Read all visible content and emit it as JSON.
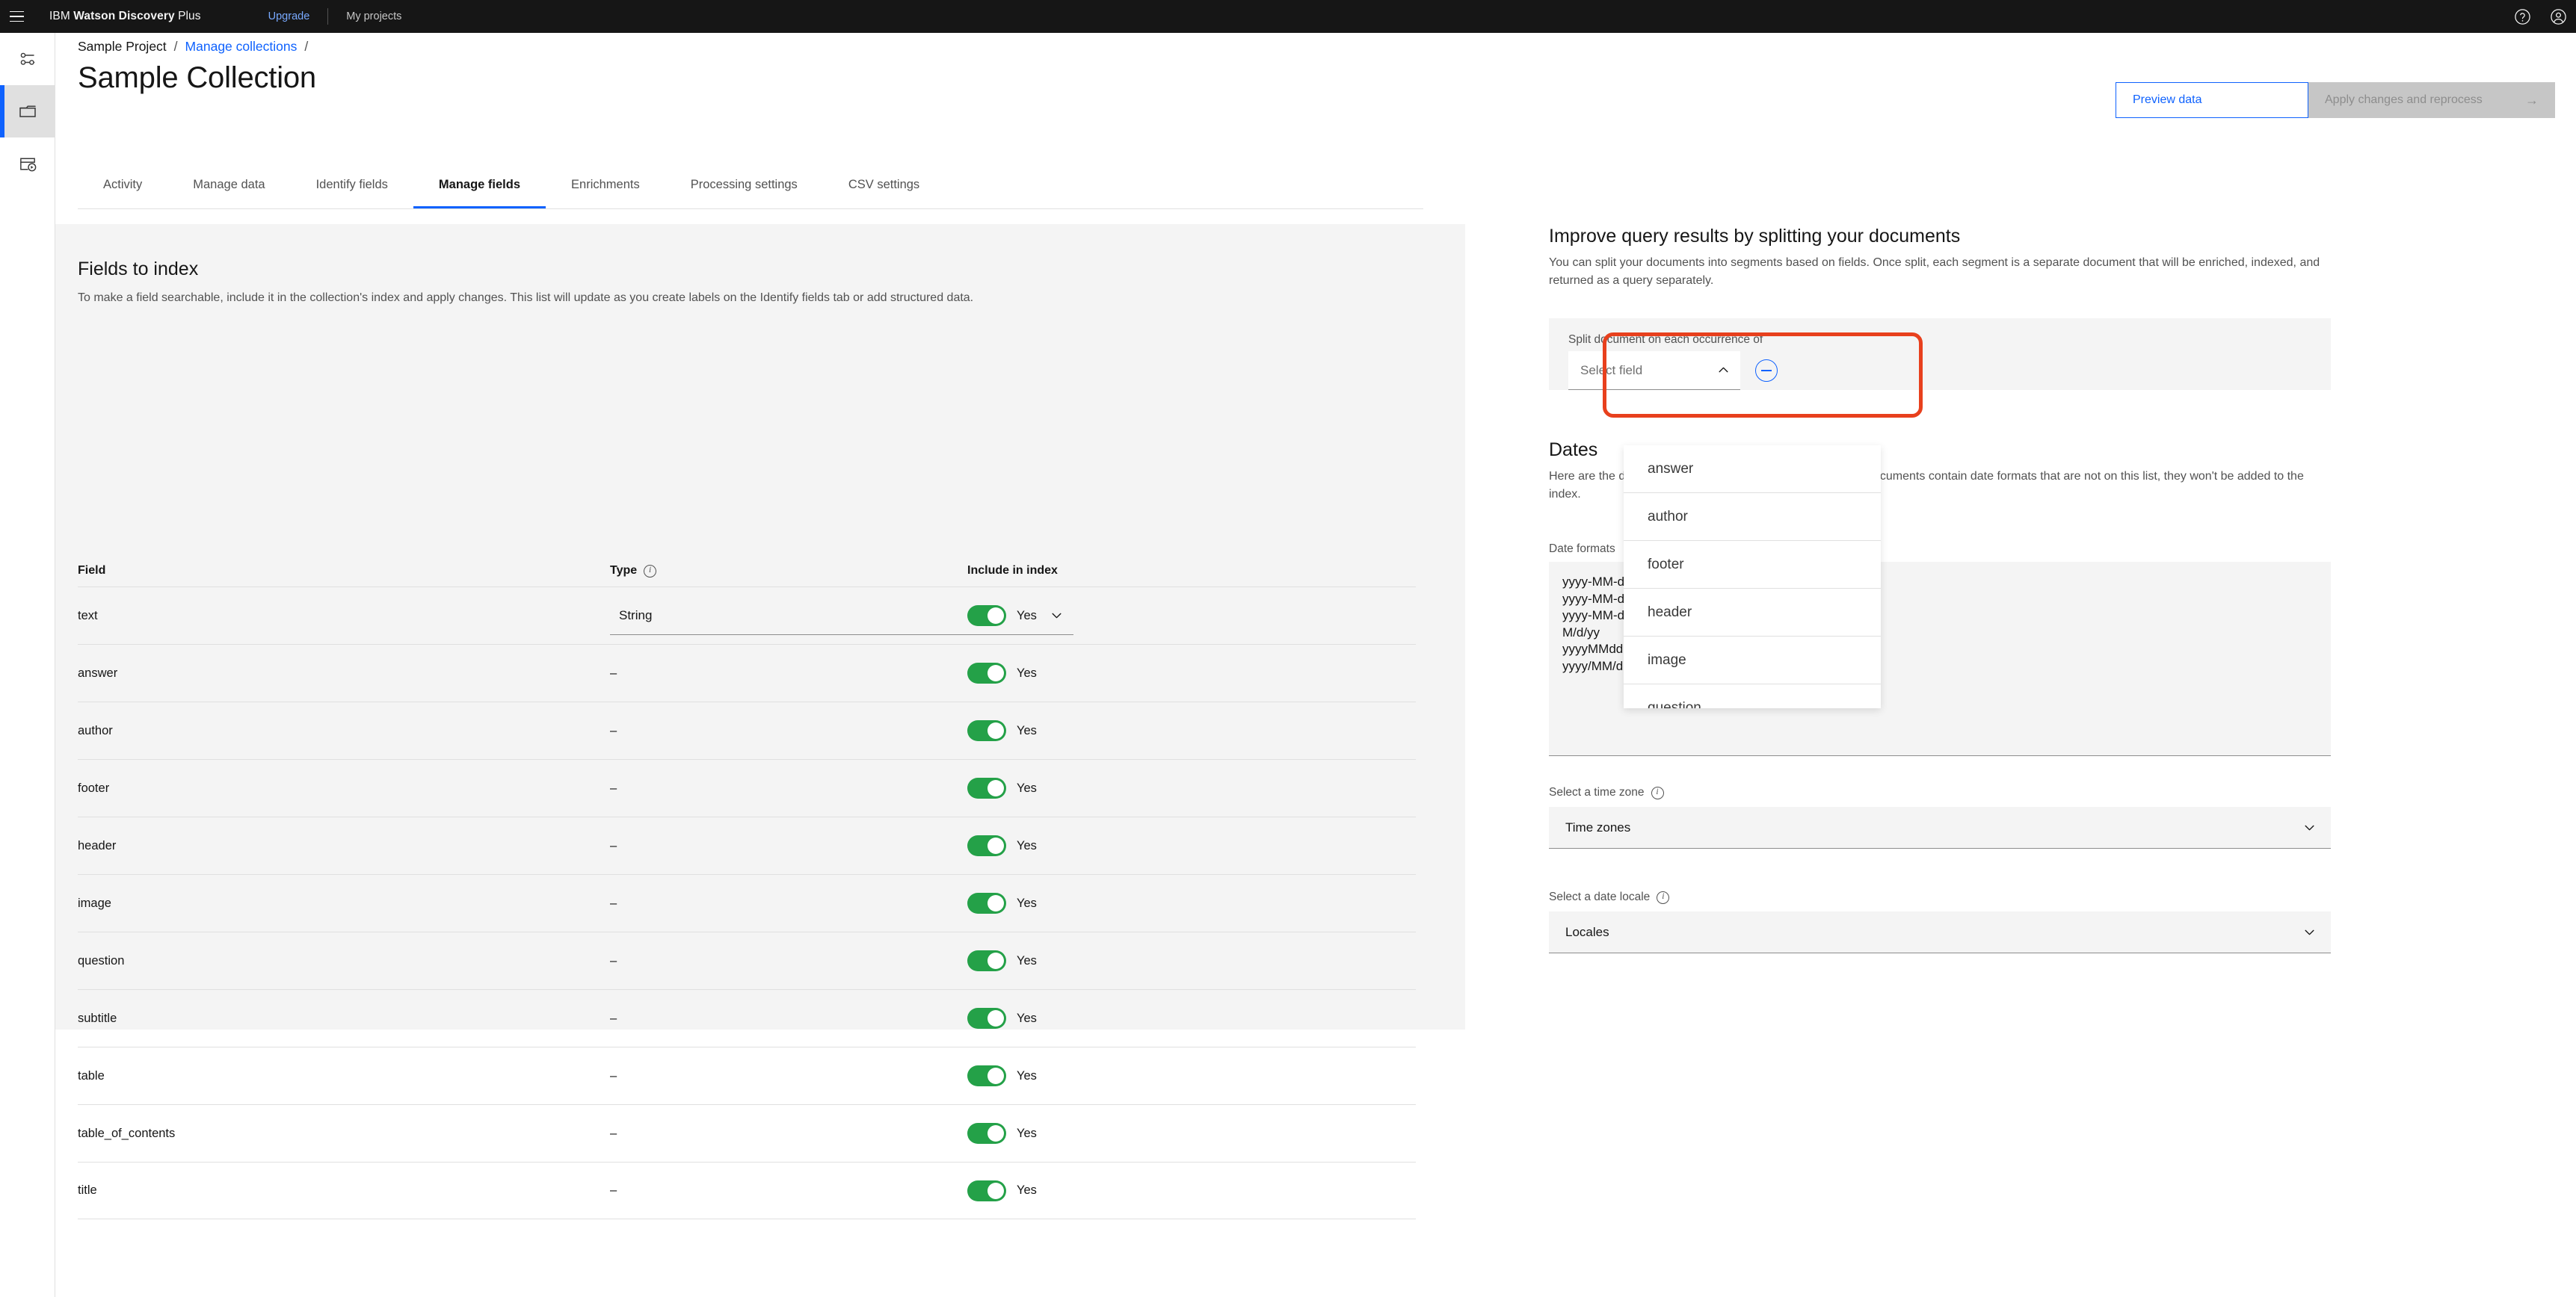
{
  "topbar": {
    "menu_icon": "hamburger-icon",
    "brand_prefix": "IBM ",
    "brand_bold": "Watson Discovery",
    "brand_suffix": " Plus",
    "nav": [
      {
        "label": "Upgrade",
        "style": "link"
      },
      {
        "label": "My projects",
        "style": "plain"
      }
    ],
    "help_icon": "help-icon",
    "account_icon": "user-avatar-icon"
  },
  "rail": {
    "items": [
      {
        "icon": "settings-sliders-icon",
        "active": false
      },
      {
        "icon": "folder-icon",
        "active": true
      },
      {
        "icon": "document-play-icon",
        "active": false
      }
    ]
  },
  "breadcrumb": {
    "items": [
      {
        "label": "Sample Project",
        "link": false
      },
      {
        "label": "Manage collections",
        "link": true
      }
    ],
    "separator": "/",
    "trailing_separator": "/"
  },
  "page": {
    "title": "Sample Collection"
  },
  "header_actions": {
    "preview_label": "Preview data",
    "apply_label": "Apply changes and reprocess",
    "apply_arrow": "→",
    "apply_disabled": true
  },
  "tabs": [
    {
      "label": "Activity",
      "active": false
    },
    {
      "label": "Manage data",
      "active": false
    },
    {
      "label": "Identify fields",
      "active": false
    },
    {
      "label": "Manage fields",
      "active": true
    },
    {
      "label": "Enrichments",
      "active": false
    },
    {
      "label": "Processing settings",
      "active": false
    },
    {
      "label": "CSV settings",
      "active": false
    }
  ],
  "fields_card": {
    "title": "Fields to index",
    "subtitle": "To make a field searchable, include it in the collection's index and apply changes. This list will update as you create labels on the Identify fields tab or add structured data.",
    "columns": {
      "field": "Field",
      "type": "Type",
      "type_info_icon": "info-icon",
      "include": "Include in index"
    },
    "rows": [
      {
        "field": "text",
        "type": "String",
        "type_is_select": true,
        "include": "Yes",
        "on": true
      },
      {
        "field": "answer",
        "type": "–",
        "type_is_select": false,
        "include": "Yes",
        "on": true
      },
      {
        "field": "author",
        "type": "–",
        "type_is_select": false,
        "include": "Yes",
        "on": true
      },
      {
        "field": "footer",
        "type": "–",
        "type_is_select": false,
        "include": "Yes",
        "on": true
      },
      {
        "field": "header",
        "type": "–",
        "type_is_select": false,
        "include": "Yes",
        "on": true
      },
      {
        "field": "image",
        "type": "–",
        "type_is_select": false,
        "include": "Yes",
        "on": true
      },
      {
        "field": "question",
        "type": "–",
        "type_is_select": false,
        "include": "Yes",
        "on": true
      },
      {
        "field": "subtitle",
        "type": "–",
        "type_is_select": false,
        "include": "Yes",
        "on": true
      },
      {
        "field": "table",
        "type": "–",
        "type_is_select": false,
        "include": "Yes",
        "on": true
      },
      {
        "field": "table_of_contents",
        "type": "–",
        "type_is_select": false,
        "include": "Yes",
        "on": true
      },
      {
        "field": "title",
        "type": "–",
        "type_is_select": false,
        "include": "Yes",
        "on": true
      }
    ]
  },
  "split_card": {
    "title": "Improve query results by splitting your documents",
    "body": "You can split your documents into segments based on fields. Once split, each segment is a separate document that will be enriched, indexed, and returned as a query separately.",
    "split_label": "Split document on each occurrence of",
    "select_placeholder": "Select field",
    "chevron_icon": "chevron-up-icon",
    "remove_icon": "minus-circle-icon",
    "highlight_color": "#e8401d"
  },
  "field_dropdown": {
    "open": true,
    "options": [
      "answer",
      "author",
      "footer",
      "header",
      "image",
      "question"
    ]
  },
  "date_card": {
    "title": "Dates",
    "body": "Here are the date formats currently being supported. If your documents contain date formats that are not on this list, they won't be added to the index.",
    "formats_label": "Date formats",
    "formats_value": "yyyy-MM-dd'T'HH:mm:ss.SSSZ\nyyyy-MM-dd'T'HH:mm:ss.SSSX\nyyyy-MM-dd\nM/d/yy\nyyyyMMdd\nyyyy/MM/dd",
    "timezone_label": "Select a time zone",
    "timezone_info_icon": "info-icon",
    "timezone_value": "Time zones",
    "locale_label": "Select a date locale",
    "locale_info_icon": "info-icon",
    "locale_value": "Locales",
    "chevron_icon": "chevron-down-icon"
  }
}
